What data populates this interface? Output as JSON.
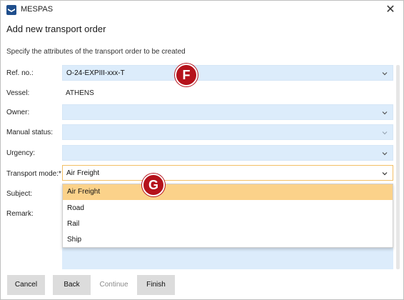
{
  "window": {
    "app_title": "MESPAS",
    "close_glyph": "✕"
  },
  "dialog": {
    "title": "Add new transport order",
    "subtitle": "Specify the attributes of the transport order to be created"
  },
  "form": {
    "ref_no": {
      "label": "Ref. no.:",
      "value": "O-24-EXPIII-xxx-T"
    },
    "vessel": {
      "label": "Vessel:",
      "value": "ATHENS"
    },
    "owner": {
      "label": "Owner:",
      "value": ""
    },
    "manual_status": {
      "label": "Manual status:",
      "value": ""
    },
    "urgency": {
      "label": "Urgency:",
      "value": ""
    },
    "transport_mode": {
      "label": "Transport mode:*",
      "value": "Air Freight"
    },
    "subject": {
      "label": "Subject:"
    },
    "remark": {
      "label": "Remark:"
    }
  },
  "transport_mode_options": [
    "Air Freight",
    "Road",
    "Rail",
    "Ship"
  ],
  "badges": {
    "f": "F",
    "g": "G"
  },
  "footer": {
    "cancel": "Cancel",
    "back": "Back",
    "continue": "Continue",
    "finish": "Finish"
  },
  "colors": {
    "field_bg": "#dcecfb",
    "selected_option": "#fbd28a",
    "badge": "#b5121b",
    "focus_border": "#f2bf66"
  },
  "icons": {
    "app": "mespas-logo-icon",
    "close": "close-icon",
    "dropdown": "chevron-down-icon"
  }
}
